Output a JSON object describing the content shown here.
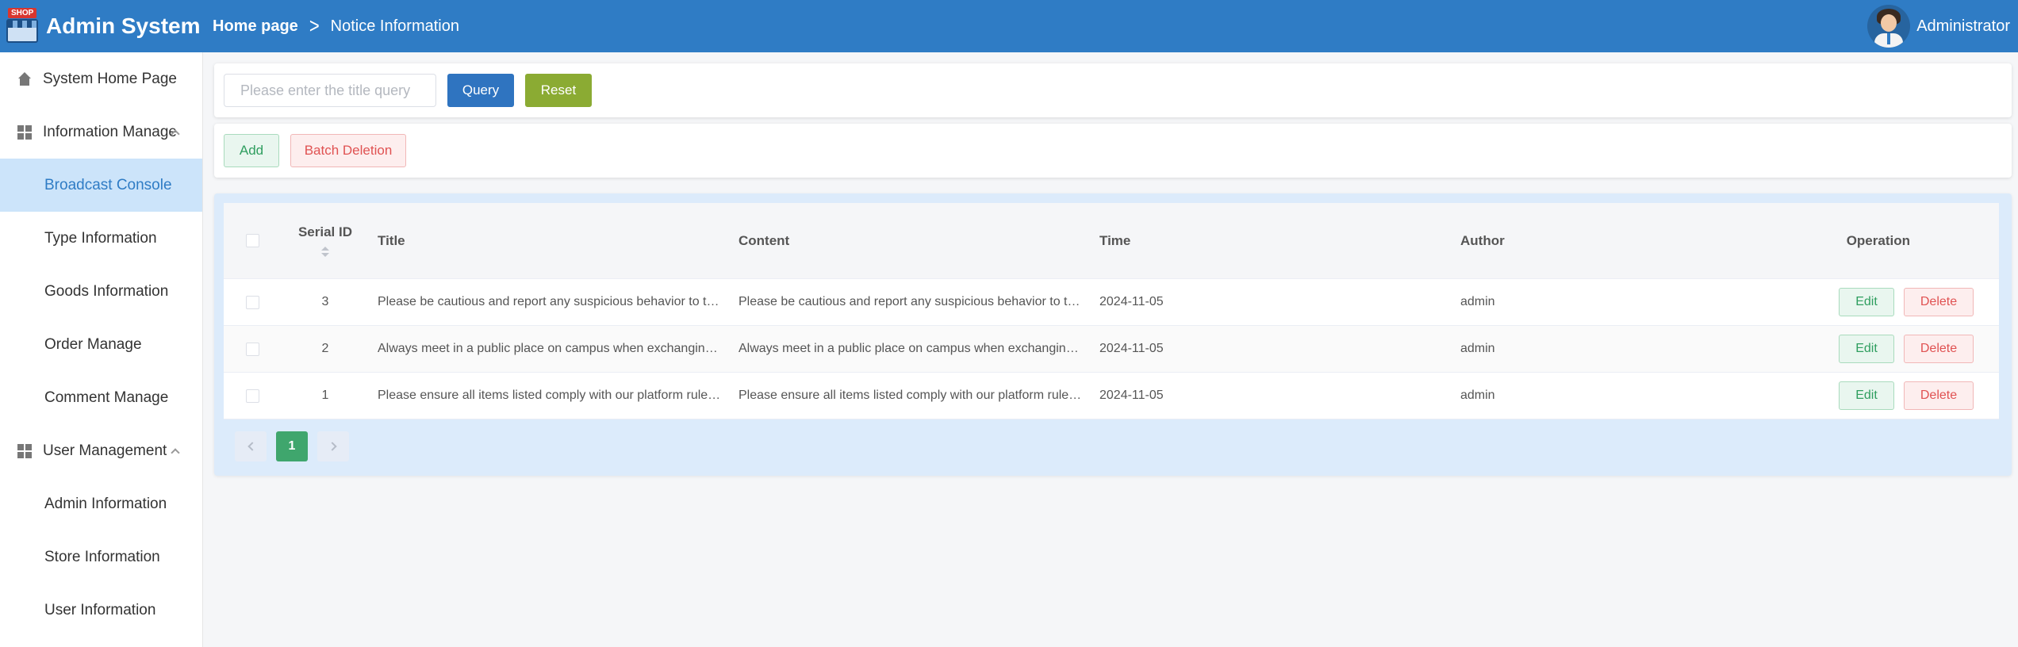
{
  "header": {
    "logo_text": "SHOP",
    "app_title": "Admin System",
    "breadcrumb": {
      "home": "Home page",
      "separator": ">",
      "current": "Notice Information"
    },
    "user_name": "Administrator"
  },
  "sidebar": {
    "items": [
      {
        "label": "System Home Page",
        "icon": "home-icon"
      },
      {
        "label": "Information Manage",
        "icon": "grid-icon"
      },
      {
        "label": "Broadcast Console",
        "active": true
      },
      {
        "label": "Type Information"
      },
      {
        "label": "Goods Information"
      },
      {
        "label": "Order Manage"
      },
      {
        "label": "Comment Manage"
      },
      {
        "label": "User Management",
        "icon": "grid-icon"
      },
      {
        "label": "Admin Information"
      },
      {
        "label": "Store Information"
      },
      {
        "label": "User Information"
      }
    ]
  },
  "search": {
    "placeholder": "Please enter the title query",
    "value": "",
    "query_label": "Query",
    "reset_label": "Reset"
  },
  "actions": {
    "add_label": "Add",
    "batch_delete_label": "Batch Deletion"
  },
  "table": {
    "columns": [
      "Serial ID",
      "Title",
      "Content",
      "Time",
      "Author",
      "Operation"
    ],
    "edit_label": "Edit",
    "delete_label": "Delete",
    "rows": [
      {
        "id": "3",
        "title": "Please be cautious and report any suspicious behavior to the...",
        "content": "Please be cautious and report any suspicious behavior to the...",
        "time": "2024-11-05",
        "author": "admin"
      },
      {
        "id": "2",
        "title": "Always meet in a public place on campus when exchanging ...",
        "content": "Always meet in a public place on campus when exchanging ...",
        "time": "2024-11-05",
        "author": "admin"
      },
      {
        "id": "1",
        "title": "Please ensure all items listed comply with our platform rules....",
        "content": "Please ensure all items listed comply with our platform rules....",
        "time": "2024-11-05",
        "author": "admin"
      }
    ]
  },
  "pagination": {
    "current_page": "1"
  },
  "colors": {
    "header_bg": "#2f7cc5",
    "active_menu_bg": "#cce4fa",
    "query_button": "#2f74c0",
    "reset_button": "#8bab33",
    "page_active": "#3fa66d"
  }
}
